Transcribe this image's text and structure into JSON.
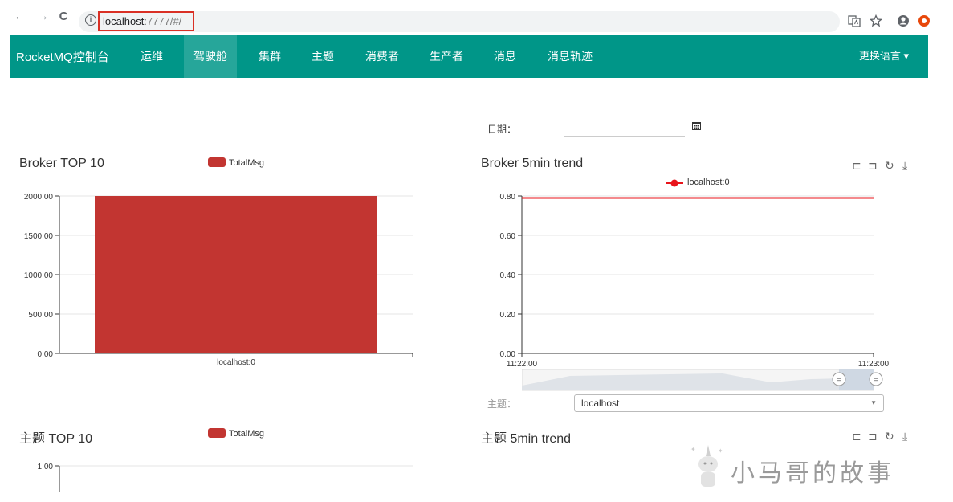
{
  "browser": {
    "back": "←",
    "forward": "→",
    "reload": "C",
    "info": "i",
    "url_host": "localhost",
    "url_rest": ":7777/#/"
  },
  "app": {
    "brand": "RocketMQ控制台",
    "nav": [
      "运维",
      "驾驶舱",
      "集群",
      "主题",
      "消费者",
      "生产者",
      "消息",
      "消息轨迹"
    ],
    "active_nav": "驾驶舱",
    "language": "更换语言 ▾"
  },
  "filters": {
    "date_label": "日期：",
    "date_value": "",
    "topic_label": "主题：",
    "topic_value": "localhost"
  },
  "charts": {
    "broker_top10_title": "Broker TOP 10",
    "broker_trend_title": "Broker 5min trend",
    "topic_top10_title": "主题 TOP 10",
    "topic_trend_title": "主题 5min trend",
    "legend_totalmsg": "TotalMsg",
    "legend_localhost": "localhost:0"
  },
  "watermark": "小马哥的故事",
  "chart_data": [
    {
      "type": "bar",
      "title": "Broker TOP 10",
      "categories": [
        "localhost:0"
      ],
      "series": [
        {
          "name": "TotalMsg",
          "values": [
            2000
          ]
        }
      ],
      "yticks": [
        "0.00",
        "500.00",
        "1000.00",
        "1500.00",
        "2000.00"
      ],
      "ylim": [
        0,
        2000
      ],
      "color": "#c23531"
    },
    {
      "type": "line",
      "title": "Broker 5min trend",
      "x": [
        "11:22:00",
        "11:23:00"
      ],
      "series": [
        {
          "name": "localhost:0",
          "values": [
            0.79,
            0.79
          ]
        }
      ],
      "yticks": [
        "0.00",
        "0.20",
        "0.40",
        "0.60",
        "0.80"
      ],
      "ylim": [
        0,
        0.8
      ],
      "color": "#e8141b"
    },
    {
      "type": "bar",
      "title": "主题 TOP 10",
      "series": [
        {
          "name": "TotalMsg",
          "values": []
        }
      ],
      "yticks": [
        "1.00"
      ],
      "color": "#c23531"
    },
    {
      "type": "line",
      "title": "主题 5min trend",
      "series": []
    }
  ]
}
